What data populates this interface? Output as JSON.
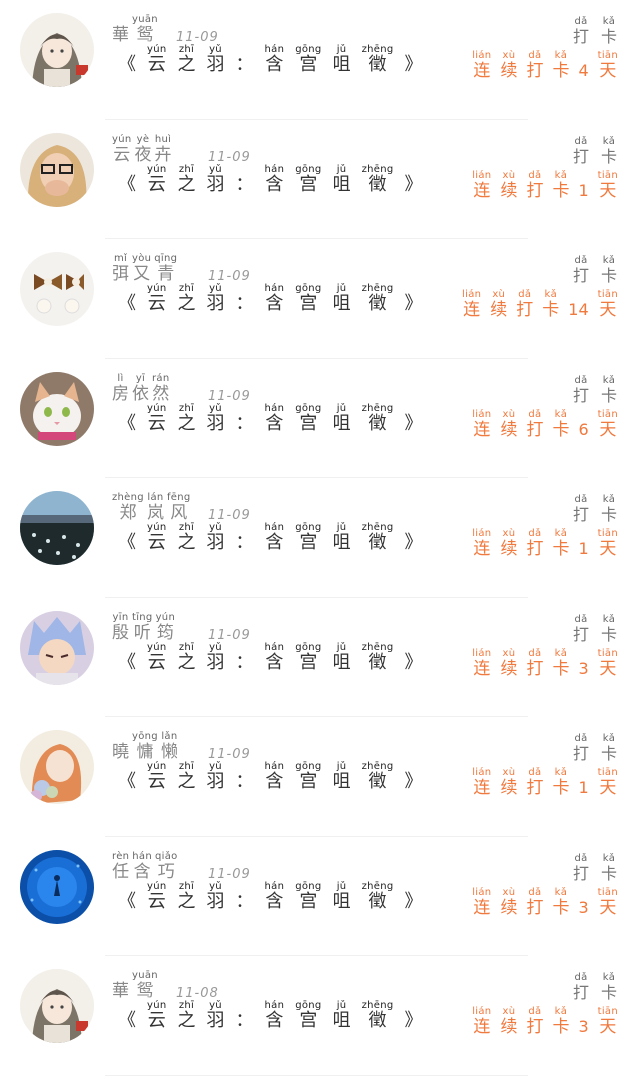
{
  "check_in_list": [
    {
      "name": [
        {
          "py": "",
          "ch": "華"
        },
        {
          "py": "yuān",
          "ch": "鸳"
        }
      ],
      "date": "11-09",
      "title_left": "《",
      "title": [
        {
          "py": "yún",
          "ch": "云"
        },
        {
          "py": "zhī",
          "ch": "之"
        },
        {
          "py": "yǔ",
          "ch": "羽"
        }
      ],
      "title_sep": "：",
      "subtitle": [
        {
          "py": "hán",
          "ch": "含"
        },
        {
          "py": "gōng",
          "ch": "宫"
        },
        {
          "py": "jǔ",
          "ch": "咀"
        },
        {
          "py": "zhēng",
          "ch": "徵"
        }
      ],
      "title_right": "》",
      "action": [
        {
          "py": "dǎ",
          "ch": "打"
        },
        {
          "py": "kǎ",
          "ch": "卡"
        }
      ],
      "streak_prefix": [
        {
          "py": "lián",
          "ch": "连"
        },
        {
          "py": "xù",
          "ch": "续"
        },
        {
          "py": "dǎ",
          "ch": "打"
        },
        {
          "py": "kǎ",
          "ch": "卡"
        }
      ],
      "days": "4",
      "streak_suffix": {
        "py": "tiān",
        "ch": "天"
      },
      "avatar": "anime-girl-avatar"
    },
    {
      "name": [
        {
          "py": "yún",
          "ch": "云"
        },
        {
          "py": "yè",
          "ch": "夜"
        },
        {
          "py": "huì",
          "ch": "卉"
        }
      ],
      "date": "11-09",
      "title_left": "《",
      "title": [
        {
          "py": "yún",
          "ch": "云"
        },
        {
          "py": "zhī",
          "ch": "之"
        },
        {
          "py": "yǔ",
          "ch": "羽"
        }
      ],
      "title_sep": "：",
      "subtitle": [
        {
          "py": "hán",
          "ch": "含"
        },
        {
          "py": "gōng",
          "ch": "宫"
        },
        {
          "py": "jǔ",
          "ch": "咀"
        },
        {
          "py": "zhēng",
          "ch": "徵"
        }
      ],
      "title_right": "》",
      "action": [
        {
          "py": "dǎ",
          "ch": "打"
        },
        {
          "py": "kǎ",
          "ch": "卡"
        }
      ],
      "streak_prefix": [
        {
          "py": "lián",
          "ch": "连"
        },
        {
          "py": "xù",
          "ch": "续"
        },
        {
          "py": "dǎ",
          "ch": "打"
        },
        {
          "py": "kǎ",
          "ch": "卡"
        }
      ],
      "days": "1",
      "streak_suffix": {
        "py": "tiān",
        "ch": "天"
      },
      "avatar": "blonde-girl-avatar"
    },
    {
      "name": [
        {
          "py": "mǐ",
          "ch": "弭"
        },
        {
          "py": "yòu",
          "ch": "又"
        },
        {
          "py": "qīng",
          "ch": "青"
        }
      ],
      "date": "11-09",
      "title_left": "《",
      "title": [
        {
          "py": "yún",
          "ch": "云"
        },
        {
          "py": "zhī",
          "ch": "之"
        },
        {
          "py": "yǔ",
          "ch": "羽"
        }
      ],
      "title_sep": "：",
      "subtitle": [
        {
          "py": "hán",
          "ch": "含"
        },
        {
          "py": "gōng",
          "ch": "宫"
        },
        {
          "py": "jǔ",
          "ch": "咀"
        },
        {
          "py": "zhēng",
          "ch": "徵"
        }
      ],
      "title_right": "》",
      "action": [
        {
          "py": "dǎ",
          "ch": "打"
        },
        {
          "py": "kǎ",
          "ch": "卡"
        }
      ],
      "streak_prefix": [
        {
          "py": "lián",
          "ch": "连"
        },
        {
          "py": "xù",
          "ch": "续"
        },
        {
          "py": "dǎ",
          "ch": "打"
        },
        {
          "py": "kǎ",
          "ch": "卡"
        }
      ],
      "days": "14",
      "streak_suffix": {
        "py": "tiān",
        "ch": "天"
      },
      "avatar": "bow-earrings-avatar"
    },
    {
      "name": [
        {
          "py": "lì",
          "ch": "房"
        },
        {
          "py": "yī",
          "ch": "依"
        },
        {
          "py": "rán",
          "ch": "然"
        }
      ],
      "date": "11-09",
      "title_left": "《",
      "title": [
        {
          "py": "yún",
          "ch": "云"
        },
        {
          "py": "zhī",
          "ch": "之"
        },
        {
          "py": "yǔ",
          "ch": "羽"
        }
      ],
      "title_sep": "：",
      "subtitle": [
        {
          "py": "hán",
          "ch": "含"
        },
        {
          "py": "gōng",
          "ch": "宫"
        },
        {
          "py": "jǔ",
          "ch": "咀"
        },
        {
          "py": "zhēng",
          "ch": "徵"
        }
      ],
      "title_right": "》",
      "action": [
        {
          "py": "dǎ",
          "ch": "打"
        },
        {
          "py": "kǎ",
          "ch": "卡"
        }
      ],
      "streak_prefix": [
        {
          "py": "lián",
          "ch": "连"
        },
        {
          "py": "xù",
          "ch": "续"
        },
        {
          "py": "dǎ",
          "ch": "打"
        },
        {
          "py": "kǎ",
          "ch": "卡"
        }
      ],
      "days": "6",
      "streak_suffix": {
        "py": "tiān",
        "ch": "天"
      },
      "avatar": "cat-avatar"
    },
    {
      "name": [
        {
          "py": "zhèng",
          "ch": "郑"
        },
        {
          "py": "lán",
          "ch": "岚"
        },
        {
          "py": "fēng",
          "ch": "风"
        }
      ],
      "date": "11-09",
      "title_left": "《",
      "title": [
        {
          "py": "yún",
          "ch": "云"
        },
        {
          "py": "zhī",
          "ch": "之"
        },
        {
          "py": "yǔ",
          "ch": "羽"
        }
      ],
      "title_sep": "：",
      "subtitle": [
        {
          "py": "hán",
          "ch": "含"
        },
        {
          "py": "gōng",
          "ch": "宫"
        },
        {
          "py": "jǔ",
          "ch": "咀"
        },
        {
          "py": "zhēng",
          "ch": "徵"
        }
      ],
      "title_right": "》",
      "action": [
        {
          "py": "dǎ",
          "ch": "打"
        },
        {
          "py": "kǎ",
          "ch": "卡"
        }
      ],
      "streak_prefix": [
        {
          "py": "lián",
          "ch": "连"
        },
        {
          "py": "xù",
          "ch": "续"
        },
        {
          "py": "dǎ",
          "ch": "打"
        },
        {
          "py": "kǎ",
          "ch": "卡"
        }
      ],
      "days": "1",
      "streak_suffix": {
        "py": "tiān",
        "ch": "天"
      },
      "avatar": "lake-avatar"
    },
    {
      "name": [
        {
          "py": "yīn",
          "ch": "殷"
        },
        {
          "py": "tīng",
          "ch": "听"
        },
        {
          "py": "yún",
          "ch": "筠"
        }
      ],
      "date": "11-09",
      "title_left": "《",
      "title": [
        {
          "py": "yún",
          "ch": "云"
        },
        {
          "py": "zhī",
          "ch": "之"
        },
        {
          "py": "yǔ",
          "ch": "羽"
        }
      ],
      "title_sep": "：",
      "subtitle": [
        {
          "py": "hán",
          "ch": "含"
        },
        {
          "py": "gōng",
          "ch": "宫"
        },
        {
          "py": "jǔ",
          "ch": "咀"
        },
        {
          "py": "zhēng",
          "ch": "徵"
        }
      ],
      "title_right": "》",
      "action": [
        {
          "py": "dǎ",
          "ch": "打"
        },
        {
          "py": "kǎ",
          "ch": "卡"
        }
      ],
      "streak_prefix": [
        {
          "py": "lián",
          "ch": "连"
        },
        {
          "py": "xù",
          "ch": "续"
        },
        {
          "py": "dǎ",
          "ch": "打"
        },
        {
          "py": "kǎ",
          "ch": "卡"
        }
      ],
      "days": "3",
      "streak_suffix": {
        "py": "tiān",
        "ch": "天"
      },
      "avatar": "anime-boy-avatar"
    },
    {
      "name": [
        {
          "py": "",
          "ch": "曉"
        },
        {
          "py": "yōng",
          "ch": "慵"
        },
        {
          "py": "lǎn",
          "ch": "懒"
        }
      ],
      "date": "11-09",
      "title_left": "《",
      "title": [
        {
          "py": "yún",
          "ch": "云"
        },
        {
          "py": "zhī",
          "ch": "之"
        },
        {
          "py": "yǔ",
          "ch": "羽"
        }
      ],
      "title_sep": "：",
      "subtitle": [
        {
          "py": "hán",
          "ch": "含"
        },
        {
          "py": "gōng",
          "ch": "宫"
        },
        {
          "py": "jǔ",
          "ch": "咀"
        },
        {
          "py": "zhēng",
          "ch": "徵"
        }
      ],
      "title_right": "》",
      "action": [
        {
          "py": "dǎ",
          "ch": "打"
        },
        {
          "py": "kǎ",
          "ch": "卡"
        }
      ],
      "streak_prefix": [
        {
          "py": "lián",
          "ch": "连"
        },
        {
          "py": "xù",
          "ch": "续"
        },
        {
          "py": "dǎ",
          "ch": "打"
        },
        {
          "py": "kǎ",
          "ch": "卡"
        }
      ],
      "days": "1",
      "streak_suffix": {
        "py": "tiān",
        "ch": "天"
      },
      "avatar": "painted-girl-avatar"
    },
    {
      "name": [
        {
          "py": "rèn",
          "ch": "任"
        },
        {
          "py": "hán",
          "ch": "含"
        },
        {
          "py": "qiǎo",
          "ch": "巧"
        }
      ],
      "date": "11-09",
      "title_left": "《",
      "title": [
        {
          "py": "yún",
          "ch": "云"
        },
        {
          "py": "zhī",
          "ch": "之"
        },
        {
          "py": "yǔ",
          "ch": "羽"
        }
      ],
      "title_sep": "：",
      "subtitle": [
        {
          "py": "hán",
          "ch": "含"
        },
        {
          "py": "gōng",
          "ch": "宫"
        },
        {
          "py": "jǔ",
          "ch": "咀"
        },
        {
          "py": "zhēng",
          "ch": "徵"
        }
      ],
      "title_right": "》",
      "action": [
        {
          "py": "dǎ",
          "ch": "打"
        },
        {
          "py": "kǎ",
          "ch": "卡"
        }
      ],
      "streak_prefix": [
        {
          "py": "lián",
          "ch": "连"
        },
        {
          "py": "xù",
          "ch": "续"
        },
        {
          "py": "dǎ",
          "ch": "打"
        },
        {
          "py": "kǎ",
          "ch": "卡"
        }
      ],
      "days": "3",
      "streak_suffix": {
        "py": "tiān",
        "ch": "天"
      },
      "avatar": "aquarium-avatar"
    },
    {
      "name": [
        {
          "py": "",
          "ch": "華"
        },
        {
          "py": "yuān",
          "ch": "鸳"
        }
      ],
      "date": "11-08",
      "title_left": "《",
      "title": [
        {
          "py": "yún",
          "ch": "云"
        },
        {
          "py": "zhī",
          "ch": "之"
        },
        {
          "py": "yǔ",
          "ch": "羽"
        }
      ],
      "title_sep": "：",
      "subtitle": [
        {
          "py": "hán",
          "ch": "含"
        },
        {
          "py": "gōng",
          "ch": "宫"
        },
        {
          "py": "jǔ",
          "ch": "咀"
        },
        {
          "py": "zhēng",
          "ch": "徵"
        }
      ],
      "title_right": "》",
      "action": [
        {
          "py": "dǎ",
          "ch": "打"
        },
        {
          "py": "kǎ",
          "ch": "卡"
        }
      ],
      "streak_prefix": [
        {
          "py": "lián",
          "ch": "连"
        },
        {
          "py": "xù",
          "ch": "续"
        },
        {
          "py": "dǎ",
          "ch": "打"
        },
        {
          "py": "kǎ",
          "ch": "卡"
        }
      ],
      "days": "3",
      "streak_suffix": {
        "py": "tiān",
        "ch": "天"
      },
      "avatar": "anime-girl-avatar"
    }
  ],
  "colors": {
    "accent": "#f0793e",
    "title": "#333333",
    "meta": "#999999"
  }
}
